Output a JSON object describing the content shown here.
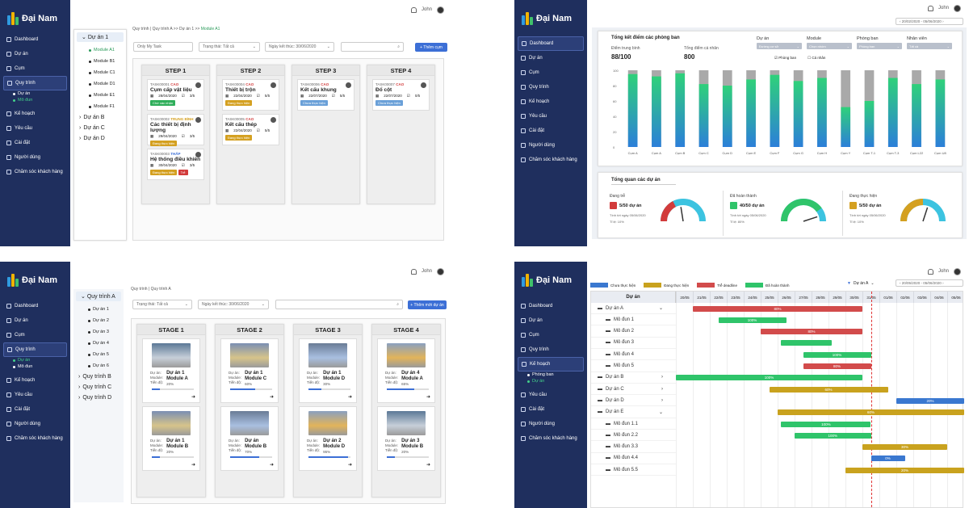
{
  "app": {
    "brand": "Đại Nam",
    "user": "John"
  },
  "nav": {
    "dashboard": "Dashboard",
    "du_an": "Dự án",
    "cum": "Cụm",
    "quy_trinh": "Quy trình",
    "ke_hoach": "Kế hoạch",
    "yeu_cau": "Yêu cầu",
    "cai_dat": "Cài đặt",
    "nguoi_dung": "Người dùng",
    "cham_soc": "Chăm sóc khách hàng"
  },
  "p1": {
    "sub": [
      "Dự án",
      "Mô đun"
    ],
    "crumb": [
      "Quy trình",
      "Quy trình A",
      "Dự án 1",
      "Module A1"
    ],
    "tree": {
      "root": "Dự án 1",
      "modules": [
        "Module A1",
        "Module B1",
        "Module C1",
        "Module D1",
        "Module E1",
        "Module F1"
      ],
      "groups": [
        "Dự án B",
        "Dự án C",
        "Dự án D"
      ]
    },
    "filters": {
      "my_task": "Only My Task",
      "status": "Trạng thái: Tất cả",
      "deadline": "Ngày kết thúc: 30/06/2020",
      "add": "+ Thêm cụm"
    },
    "steps": [
      {
        "title": "STEP 1",
        "tasks": [
          {
            "id": "TASK00001",
            "pri": "CAO",
            "name": "Cụm cấp vật liệu",
            "date": "28/04/2020",
            "count": "3/5",
            "tag": "Chờ xác nhận",
            "tagColor": "#2fae5a",
            "priColor": "#d23b3b"
          },
          {
            "id": "TASK00002",
            "pri": "TRUNG BÌNH",
            "name": "Các thiết bị định lượng",
            "date": "29/04/2020",
            "count": "3/5",
            "tag": "Đang thực hiện",
            "tagColor": "#d4a020",
            "priColor": "#d4a020"
          },
          {
            "id": "TASK00003",
            "pri": "THẤP",
            "name": "Hệ thống điều khiển",
            "date": "30/04/2020",
            "count": "3/5",
            "tag": "Đang thực hiện",
            "tagColor": "#d4a020",
            "priColor": "#3c6fd6",
            "tag2": "Trễ"
          }
        ]
      },
      {
        "title": "STEP 2",
        "tasks": [
          {
            "id": "TASK00004",
            "pri": "CAO",
            "name": "Thiết bị trộn",
            "date": "22/04/2020",
            "count": "5/5",
            "tag": "Đang thực hiện",
            "tagColor": "#d4a020",
            "priColor": "#d23b3b"
          },
          {
            "id": "TASK00005",
            "pri": "CAO",
            "name": "Kết cấu thép",
            "date": "22/04/2020",
            "count": "5/5",
            "tag": "Đang thực hiện",
            "tagColor": "#d4a020",
            "priColor": "#d23b3b"
          }
        ]
      },
      {
        "title": "STEP 3",
        "tasks": [
          {
            "id": "TASK00006",
            "pri": "CAO",
            "name": "Kết cấu khung",
            "date": "22/07/2020",
            "count": "5/5",
            "tag": "Chưa thực hiện",
            "tagColor": "#6aa0d8",
            "priColor": "#d23b3b"
          }
        ]
      },
      {
        "title": "STEP 4",
        "tasks": [
          {
            "id": "TASK00007",
            "pri": "CAO",
            "name": "Đổ cột",
            "date": "22/07/2020",
            "count": "0/5",
            "tag": "Chưa thực hiện",
            "tagColor": "#6aa0d8",
            "priColor": "#d23b3b"
          }
        ]
      }
    ]
  },
  "p2": {
    "date_range": "20/02/2020 - 05/06/2020",
    "title": "Tổng kết điểm các phòng ban",
    "avg_label": "Điểm trung bình",
    "avg_value": "88/100",
    "total_label": "Tổng điểm cá nhân",
    "total_value": "800",
    "filters": [
      {
        "label": "Dự án",
        "value": "Đường cơ sở"
      },
      {
        "label": "Module",
        "value": "Chọn nhóm"
      },
      {
        "label": "Phòng ban",
        "value": "Phòng ban"
      },
      {
        "label": "Nhân viên",
        "value": "Tất cả"
      }
    ],
    "radio": [
      "Phòng ban",
      "Cá nhân"
    ],
    "overview_title": "Tổng quan các dự án",
    "kpis": [
      {
        "label": "Đang trễ",
        "value": "5/50 dự án",
        "date": "Tính tới ngày 05/06/2020",
        "pct": "Tỉ lệ: 10%",
        "color": "#d23b3b"
      },
      {
        "label": "Đã hoàn thành",
        "value": "40/50 dự án",
        "date": "Tính tới ngày 05/06/2020",
        "pct": "Tỉ lệ: 80%",
        "color": "#2fc46a"
      },
      {
        "label": "Đang thực hiện",
        "value": "5/50 dự án",
        "date": "Tính tới ngày 05/06/2020",
        "pct": "Tỉ lệ: 10%",
        "color": "#d4a020"
      }
    ],
    "gauge_fill": [
      0.35,
      0.8,
      0.5
    ]
  },
  "chart_data": {
    "type": "bar",
    "categories": [
      "Cụm A",
      "Cụm A",
      "Cụm B",
      "Cụm C",
      "Cụm D",
      "Cụm E",
      "Cụm F",
      "Cụm G",
      "Cụm H",
      "Cụm Y",
      "Cụm T-1",
      "Cụm T-3",
      "Cụm L22",
      "Cụm U8"
    ],
    "series": [
      {
        "values": [
          95,
          92,
          96,
          82,
          80,
          88,
          94,
          86,
          90,
          52,
          60,
          90,
          82,
          88
        ]
      }
    ],
    "ylim": [
      0,
      100
    ],
    "yticks": [
      "100",
      "80",
      "60",
      "40",
      "20",
      "0"
    ]
  },
  "p3": {
    "sub": [
      "Dự án",
      "Mô đun"
    ],
    "crumb": [
      "Quy trình",
      "Quy trình A"
    ],
    "tree": {
      "root": "Quy trình A",
      "items": [
        "Dự án 1",
        "Dự án 2",
        "Dự án 3",
        "Dự án 4",
        "Dự án 5",
        "Dự án 6"
      ],
      "groups": [
        "Quy trình B",
        "Quy trình C",
        "Quy trình D"
      ]
    },
    "filters": {
      "status": "Trạng thái: Tất cả",
      "deadline": "Ngày kết thúc: 30/06/2020",
      "add": "+ Thêm mới dự án"
    },
    "labels": {
      "project": "Dự án:",
      "module": "Module:",
      "progress": "Tiến độ:"
    },
    "stages": [
      {
        "title": "STAGE 1",
        "cards": [
          {
            "p": "Dự án 1",
            "m": "Module A",
            "v": 20
          },
          {
            "p": "Dự án 1",
            "m": "Module B",
            "v": 20
          }
        ]
      },
      {
        "title": "STAGE 2",
        "cards": [
          {
            "p": "Dự án 1",
            "m": "Module C",
            "v": 60
          },
          {
            "p": "Dự án",
            "m": "Module B",
            "v": 70
          }
        ]
      },
      {
        "title": "STAGE 3",
        "cards": [
          {
            "p": "Dự án 1",
            "m": "Module D",
            "v": 30
          },
          {
            "p": "Dự án 2",
            "m": "Module D",
            "v": 95
          }
        ]
      },
      {
        "title": "STAGE 4",
        "cards": [
          {
            "p": "Dự án 4",
            "m": "Module A",
            "v": 65
          },
          {
            "p": "Dự án 3",
            "m": "Module B",
            "v": 20
          }
        ]
      }
    ]
  },
  "p4": {
    "sub": [
      "Phòng ban",
      "Dự án"
    ],
    "legend": [
      {
        "label": "Chưa thực hiện",
        "color": "#3a78d0"
      },
      {
        "label": "Đang thực hiện",
        "color": "#c9a21e"
      },
      {
        "label": "Trễ deadline",
        "color": "#d24b4b"
      },
      {
        "label": "Đã hoàn thành",
        "color": "#2fc46a"
      }
    ],
    "filter": "Dự án A",
    "date_range": "20/05/2020 - 05/06/2020",
    "col_header": "Dự án",
    "dates": [
      "20/05",
      "21/05",
      "22/05",
      "23/05",
      "24/05",
      "25/05",
      "26/05",
      "27/05",
      "28/05",
      "29/05",
      "30/05",
      "31/05",
      "01/06",
      "02/06",
      "03/06",
      "04/06",
      "05/06"
    ],
    "rows": [
      {
        "label": "Dự án A",
        "level": 0,
        "start": 1,
        "len": 10,
        "pct": "80%",
        "color": "#d24b4b",
        "chev": "v"
      },
      {
        "label": "Mô đun 1",
        "level": 1,
        "start": 2.5,
        "len": 4,
        "pct": "100%",
        "color": "#2fc46a"
      },
      {
        "label": "Mô đun 2",
        "level": 1,
        "start": 5,
        "len": 6,
        "pct": "80%",
        "color": "#d24b4b"
      },
      {
        "label": "Mô đun 3",
        "level": 1,
        "start": 6.2,
        "len": 3,
        "pct": "",
        "color": "#2fc46a"
      },
      {
        "label": "Mô đun 4",
        "level": 1,
        "start": 7.5,
        "len": 4,
        "pct": "100%",
        "color": "#2fc46a"
      },
      {
        "label": "Mô đun 5",
        "level": 1,
        "start": 7.5,
        "len": 4,
        "pct": "80%",
        "color": "#d24b4b"
      },
      {
        "label": "Dự án B",
        "level": 0,
        "start": 0,
        "len": 11,
        "pct": "100%",
        "color": "#2fc46a",
        "chev": ">"
      },
      {
        "label": "Dự án C",
        "level": 0,
        "start": 5.5,
        "len": 7,
        "pct": "60%",
        "color": "#c9a21e",
        "chev": ">"
      },
      {
        "label": "Dự án D",
        "level": 0,
        "start": 13,
        "len": 5,
        "pct": "20%",
        "color": "#3a78d0",
        "chev": ">"
      },
      {
        "label": "Dự án E",
        "level": 0,
        "start": 6,
        "len": 12,
        "pct": "60%",
        "color": "#c9a21e",
        "chev": "v"
      },
      {
        "label": "Mô đun 1.1",
        "level": 1,
        "start": 6.2,
        "len": 5.3,
        "pct": "100%",
        "color": "#2fc46a"
      },
      {
        "label": "Mô đun 2.2",
        "level": 1,
        "start": 7,
        "len": 4.5,
        "pct": "100%",
        "color": "#2fc46a"
      },
      {
        "label": "Mô đun 3.3",
        "level": 1,
        "start": 11,
        "len": 5,
        "pct": "30%",
        "color": "#c9a21e"
      },
      {
        "label": "Mô đun 4.4",
        "level": 1,
        "start": 11.5,
        "len": 2,
        "pct": "0%",
        "color": "#3a78d0"
      },
      {
        "label": "Mô đun 5.5",
        "level": 1,
        "start": 10,
        "len": 8,
        "pct": "20%",
        "color": "#c9a21e"
      }
    ],
    "today_index": 11.5
  }
}
